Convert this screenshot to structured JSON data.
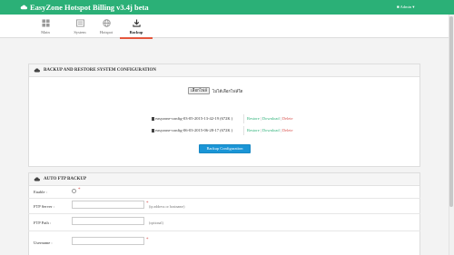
{
  "header": {
    "brand": "EasyZone Hotspot Billing v3.4j beta",
    "user": "Admin"
  },
  "tabs": [
    {
      "label": "Main",
      "icon": "dashboard-icon"
    },
    {
      "label": "System",
      "icon": "system-icon"
    },
    {
      "label": "Hotspot",
      "icon": "globe-icon"
    },
    {
      "label": "Backup",
      "icon": "download-icon",
      "active": true
    }
  ],
  "backup_panel": {
    "title": "BACKUP AND RESTORE SYSTEM CONFIGURATION",
    "file_button": "เลือกไฟล์",
    "file_status": "ไม่ได้เลือกไฟล์ใด",
    "configs": [
      {
        "name": "easyzone-config-03-05-2015-13-42-19 (672K )",
        "restore": "Restore",
        "download": "Download",
        "delete": "Delete"
      },
      {
        "name": "easyzone-config-06-03-2015-06-28-17 (672K )",
        "restore": "Restore",
        "download": "Download",
        "delete": "Delete"
      }
    ],
    "backup_button": "Backup Configuration"
  },
  "ftp_panel": {
    "title": "AUTO FTP BACKUP",
    "enable_label": "Enable :",
    "required_mark": "*",
    "server_label": "FTP Server :",
    "server_hint": "(ip address or hostname)",
    "path_label": "FTP Path :",
    "path_hint": "(optional)",
    "username_label": "Username :"
  },
  "colors": {
    "brand_green": "#2bb077",
    "tab_active": "#e4573d",
    "button_blue": "#1a95d6",
    "delete_red": "#d9534f"
  }
}
